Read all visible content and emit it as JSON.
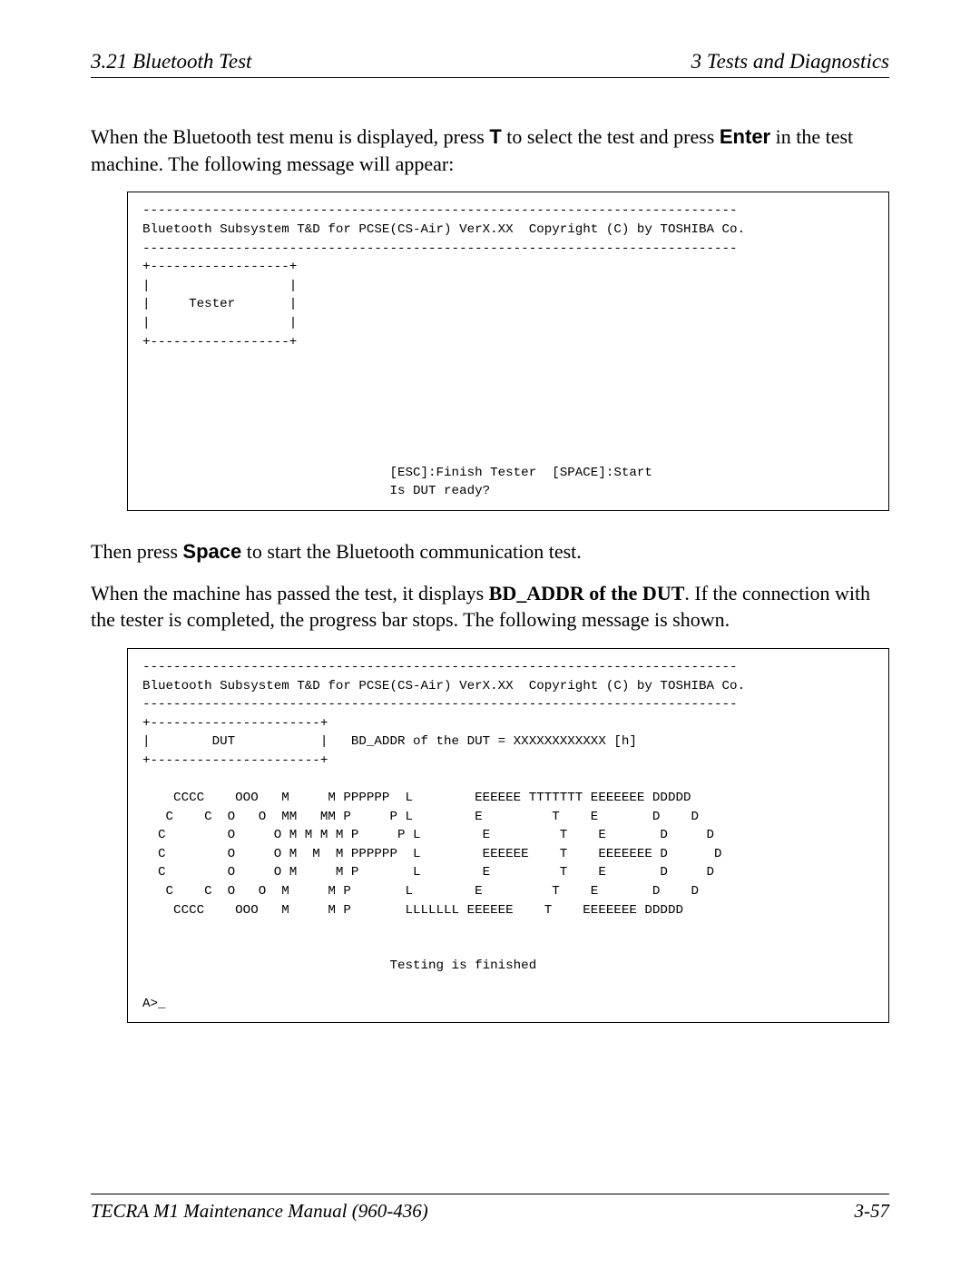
{
  "header": {
    "left": "3.21  Bluetooth Test",
    "right": "3   Tests and Diagnostics"
  },
  "para1": {
    "prefix": "When the Bluetooth test menu is displayed, press ",
    "b1": "T",
    "mid": " to select the test and press ",
    "b2": "Enter",
    "suffix": " in the test machine. The following message will appear:"
  },
  "codebox1": "-----------------------------------------------------------------------------\nBluetooth Subsystem T&D for PCSE(CS-Air) VerX.XX  Copyright (C) by TOSHIBA Co.\n-----------------------------------------------------------------------------\n+------------------+\n|                  |\n|     Tester       |\n|                  |\n+------------------+\n\n\n\n\n\n\n                                [ESC]:Finish Tester  [SPACE]:Start\n                                Is DUT ready?\n",
  "para2": {
    "prefix": "Then press ",
    "b1": "Space",
    "suffix": " to start the Bluetooth communication test."
  },
  "para3": {
    "prefix": "When the machine has passed the test, it displays ",
    "b1": "BD_ADDR of the DUT",
    "suffix": ". If the connection with the tester is completed, the progress bar stops. The following message is shown."
  },
  "codebox2": "-----------------------------------------------------------------------------\nBluetooth Subsystem T&D for PCSE(CS-Air) VerX.XX  Copyright (C) by TOSHIBA Co.\n-----------------------------------------------------------------------------\n+----------------------+\n|        DUT           |   BD_ADDR of the DUT = XXXXXXXXXXXX [h]\n+----------------------+\n\n    CCCC    OOO   M     M PPPPPP  L        EEEEEE TTTTTTT EEEEEEE DDDDD\n   C    C  O   O  MM   MM P     P L        E         T    E       D    D\n  C        O     O M M M M P     P L        E         T    E       D     D\n  C        O     O M  M  M PPPPPP  L        EEEEEE    T    EEEEEEE D      D\n  C        O     O M     M P       L        E         T    E       D     D\n   C    C  O   O  M     M P       L        E         T    E       D    D\n    CCCC    OOO   M     M P       LLLLLLL EEEEEE    T    EEEEEEE DDDDD\n\n\n                                Testing is finished\n\nA>_",
  "footer": {
    "left": "TECRA M1 Maintenance Manual (960-436)",
    "right": "3-57"
  }
}
